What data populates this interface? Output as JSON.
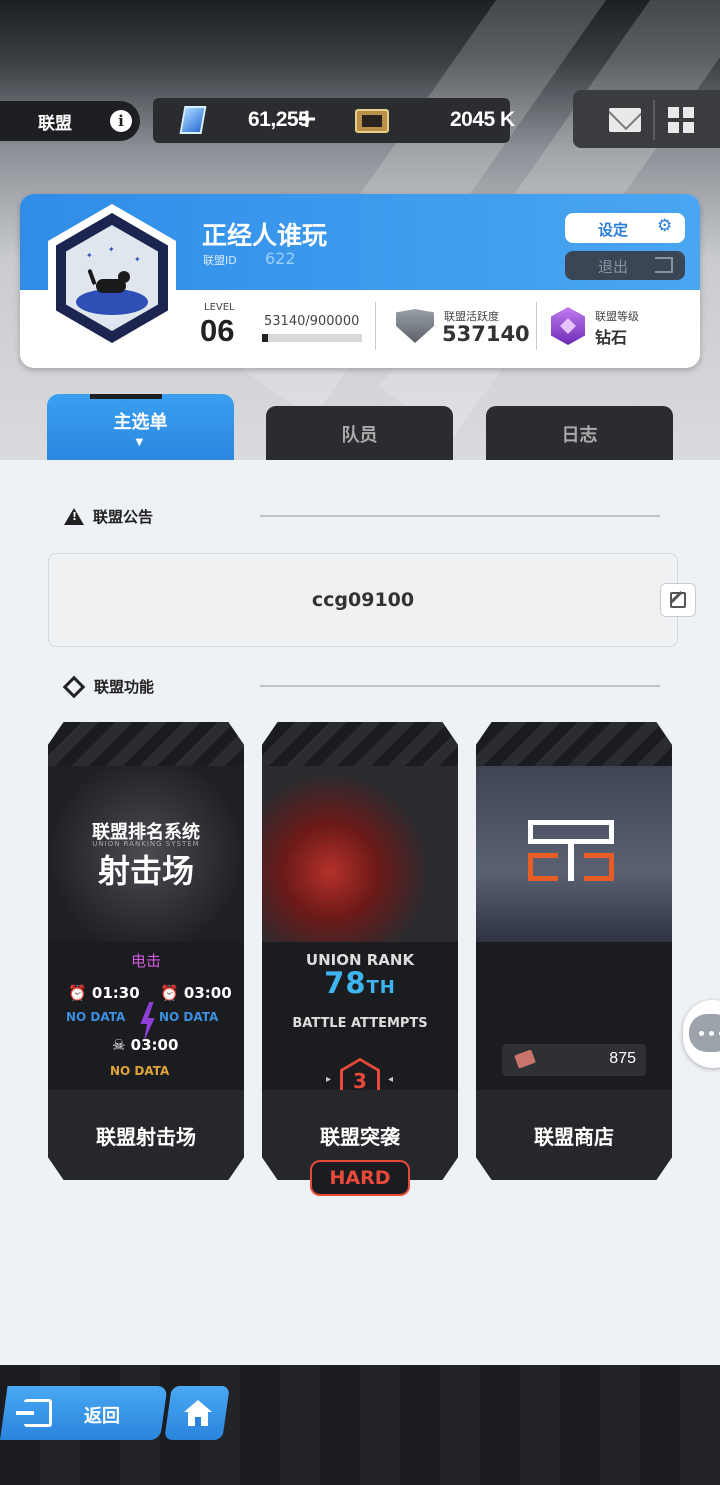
{
  "topbar": {
    "union_label": "联盟",
    "info_icon": "info-icon",
    "crystals": "61,255",
    "plus": "+",
    "tickets": "2045 K"
  },
  "profile": {
    "name": "正经人谁玩",
    "id_label": "联盟ID",
    "id_value": "622",
    "settings_label": "设定",
    "exit_label": "退出",
    "level_label": "LEVEL",
    "level_value": "06",
    "exp_text": "53140/900000",
    "exp_fraction": 0.059,
    "activity_label": "联盟活跃度",
    "activity_value": "537140",
    "grade_label": "联盟等级",
    "grade_value": "钻石"
  },
  "tabs": [
    {
      "label": "主选单",
      "active": true
    },
    {
      "label": "队员",
      "active": false
    },
    {
      "label": "日志",
      "active": false
    }
  ],
  "notice": {
    "header": "联盟公告",
    "text": "ccg09100"
  },
  "features": {
    "header": "联盟功能",
    "shooting": {
      "subtitle": "UNION RANKING SYSTEM",
      "title_line1": "联盟排名系统",
      "title_line2": "射击场",
      "element": "电击",
      "time1": "01:30",
      "time2": "03:00",
      "time3": "03:00",
      "nodata1": "NO DATA",
      "nodata2": "NO DATA",
      "nodata3": "NO DATA",
      "label": "联盟射击场"
    },
    "raid": {
      "rank_label": "UNION RANK",
      "rank_num": "78",
      "rank_suffix": "TH",
      "attempts_label": "BATTLE ATTEMPTS",
      "attempts": "3",
      "label": "联盟突袭",
      "difficulty": "HARD"
    },
    "shop": {
      "currency": "875",
      "label": "联盟商店"
    }
  },
  "bottom": {
    "back_label": "返回"
  },
  "colors": {
    "accent_blue": "#3b9ff0",
    "hard_red": "#e84a3a",
    "electric_purple": "#d25adf",
    "nodata_blue": "#3d8fe0",
    "nodata_orange": "#e0a33a"
  }
}
